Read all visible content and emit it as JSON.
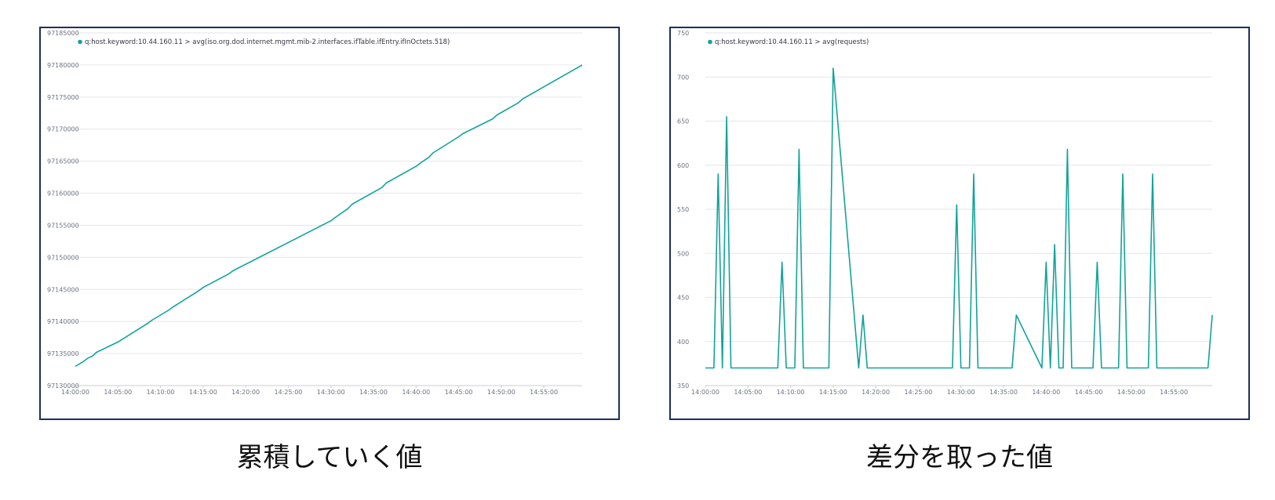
{
  "charts": [
    {
      "id": "left",
      "caption": "累積していく値",
      "chart_data": {
        "type": "line",
        "legend": {
          "position": "top-left",
          "entries": [
            "q:host.keyword:10.44.160.11 > avg(iso.org.dod.internet.mgmt.mib-2.interfaces.ifTable.ifEntry.ifInOctets.518)"
          ]
        },
        "grid": true,
        "xlim": [
          "14:00:00",
          "14:59:30"
        ],
        "ylim": [
          97130000,
          97185000
        ],
        "x_ticks": [
          "14:00:00",
          "14:05:00",
          "14:10:00",
          "14:15:00",
          "14:20:00",
          "14:25:00",
          "14:30:00",
          "14:35:00",
          "14:40:00",
          "14:45:00",
          "14:50:00",
          "14:55:00"
        ],
        "y_ticks": [
          "97130000",
          "97135000",
          "97140000",
          "97145000",
          "97150000",
          "97155000",
          "97160000",
          "97165000",
          "97170000",
          "97175000",
          "97180000",
          "97185000"
        ],
        "series": [
          {
            "name": "q:host.keyword:10.44.160.11 > avg(iso.org.dod.internet.mgmt.mib-2.interfaces.ifTable.ifEntry.ifInOctets.518)",
            "color": "#12a39a",
            "x": [
              "14:00:00",
              "14:01:00",
              "14:01:30",
              "14:02:00",
              "14:02:30",
              "14:05:00",
              "14:08:30",
              "14:09:00",
              "14:11:00",
              "14:11:30",
              "14:14:30",
              "14:15:00",
              "14:18:00",
              "14:18:30",
              "14:30:00",
              "14:30:30",
              "14:32:00",
              "14:32:30",
              "14:36:00",
              "14:36:30",
              "14:40:00",
              "14:40:30",
              "14:41:30",
              "14:42:00",
              "14:45:00",
              "14:45:30",
              "14:49:00",
              "14:49:30",
              "14:52:00",
              "14:52:30",
              "14:59:30"
            ],
            "y": [
              97133000,
              97133800,
              97134300,
              97134600,
              97135200,
              97136800,
              97139700,
              97140200,
              97141800,
              97142300,
              97144800,
              97145300,
              97147400,
              97147900,
              97155700,
              97156200,
              97157600,
              97158300,
              97160900,
              97161600,
              97164200,
              97164700,
              97165600,
              97166300,
              97168800,
              97169300,
              97171600,
              97172200,
              97174100,
              97174700,
              97180000
            ]
          }
        ]
      }
    },
    {
      "id": "right",
      "caption": "差分を取った値",
      "chart_data": {
        "type": "line",
        "legend": {
          "position": "top-left",
          "entries": [
            "q:host.keyword:10.44.160.11 > avg(requests)"
          ]
        },
        "grid": true,
        "xlim": [
          "14:00:00",
          "14:59:30"
        ],
        "ylim": [
          350,
          750
        ],
        "x_ticks": [
          "14:00:00",
          "14:05:00",
          "14:10:00",
          "14:15:00",
          "14:20:00",
          "14:25:00",
          "14:30:00",
          "14:35:00",
          "14:40:00",
          "14:45:00",
          "14:50:00",
          "14:55:00"
        ],
        "y_ticks": [
          "350",
          "400",
          "450",
          "500",
          "550",
          "600",
          "650",
          "700",
          "750"
        ],
        "series": [
          {
            "name": "q:host.keyword:10.44.160.11 > avg(requests)",
            "color": "#12a39a",
            "x": [
              "14:00:00",
              "14:00:30",
              "14:01:00",
              "14:01:30",
              "14:02:00",
              "14:02:30",
              "14:03:00",
              "14:08:30",
              "14:09:00",
              "14:09:30",
              "14:10:30",
              "14:11:00",
              "14:11:30",
              "14:14:00",
              "14:14:30",
              "14:15:00",
              "14:18:00",
              "14:18:30",
              "14:19:00",
              "14:29:00",
              "14:29:30",
              "14:30:00",
              "14:31:00",
              "14:31:30",
              "14:32:00",
              "14:35:30",
              "14:36:00",
              "14:36:30",
              "14:39:30",
              "14:40:00",
              "14:40:30",
              "14:41:00",
              "14:41:30",
              "14:42:00",
              "14:42:30",
              "14:43:00",
              "14:45:30",
              "14:46:00",
              "14:46:30",
              "14:48:30",
              "14:49:00",
              "14:49:30",
              "14:52:00",
              "14:52:30",
              "14:53:00",
              "14:59:00",
              "14:59:30"
            ],
            "y": [
              370,
              370,
              370,
              590,
              370,
              655,
              370,
              370,
              490,
              370,
              370,
              618,
              370,
              370,
              370,
              710,
              370,
              430,
              370,
              370,
              555,
              370,
              370,
              590,
              370,
              370,
              370,
              430,
              370,
              490,
              370,
              510,
              370,
              370,
              618,
              370,
              370,
              490,
              370,
              370,
              590,
              370,
              370,
              590,
              370,
              370,
              430
            ]
          }
        ]
      }
    }
  ]
}
